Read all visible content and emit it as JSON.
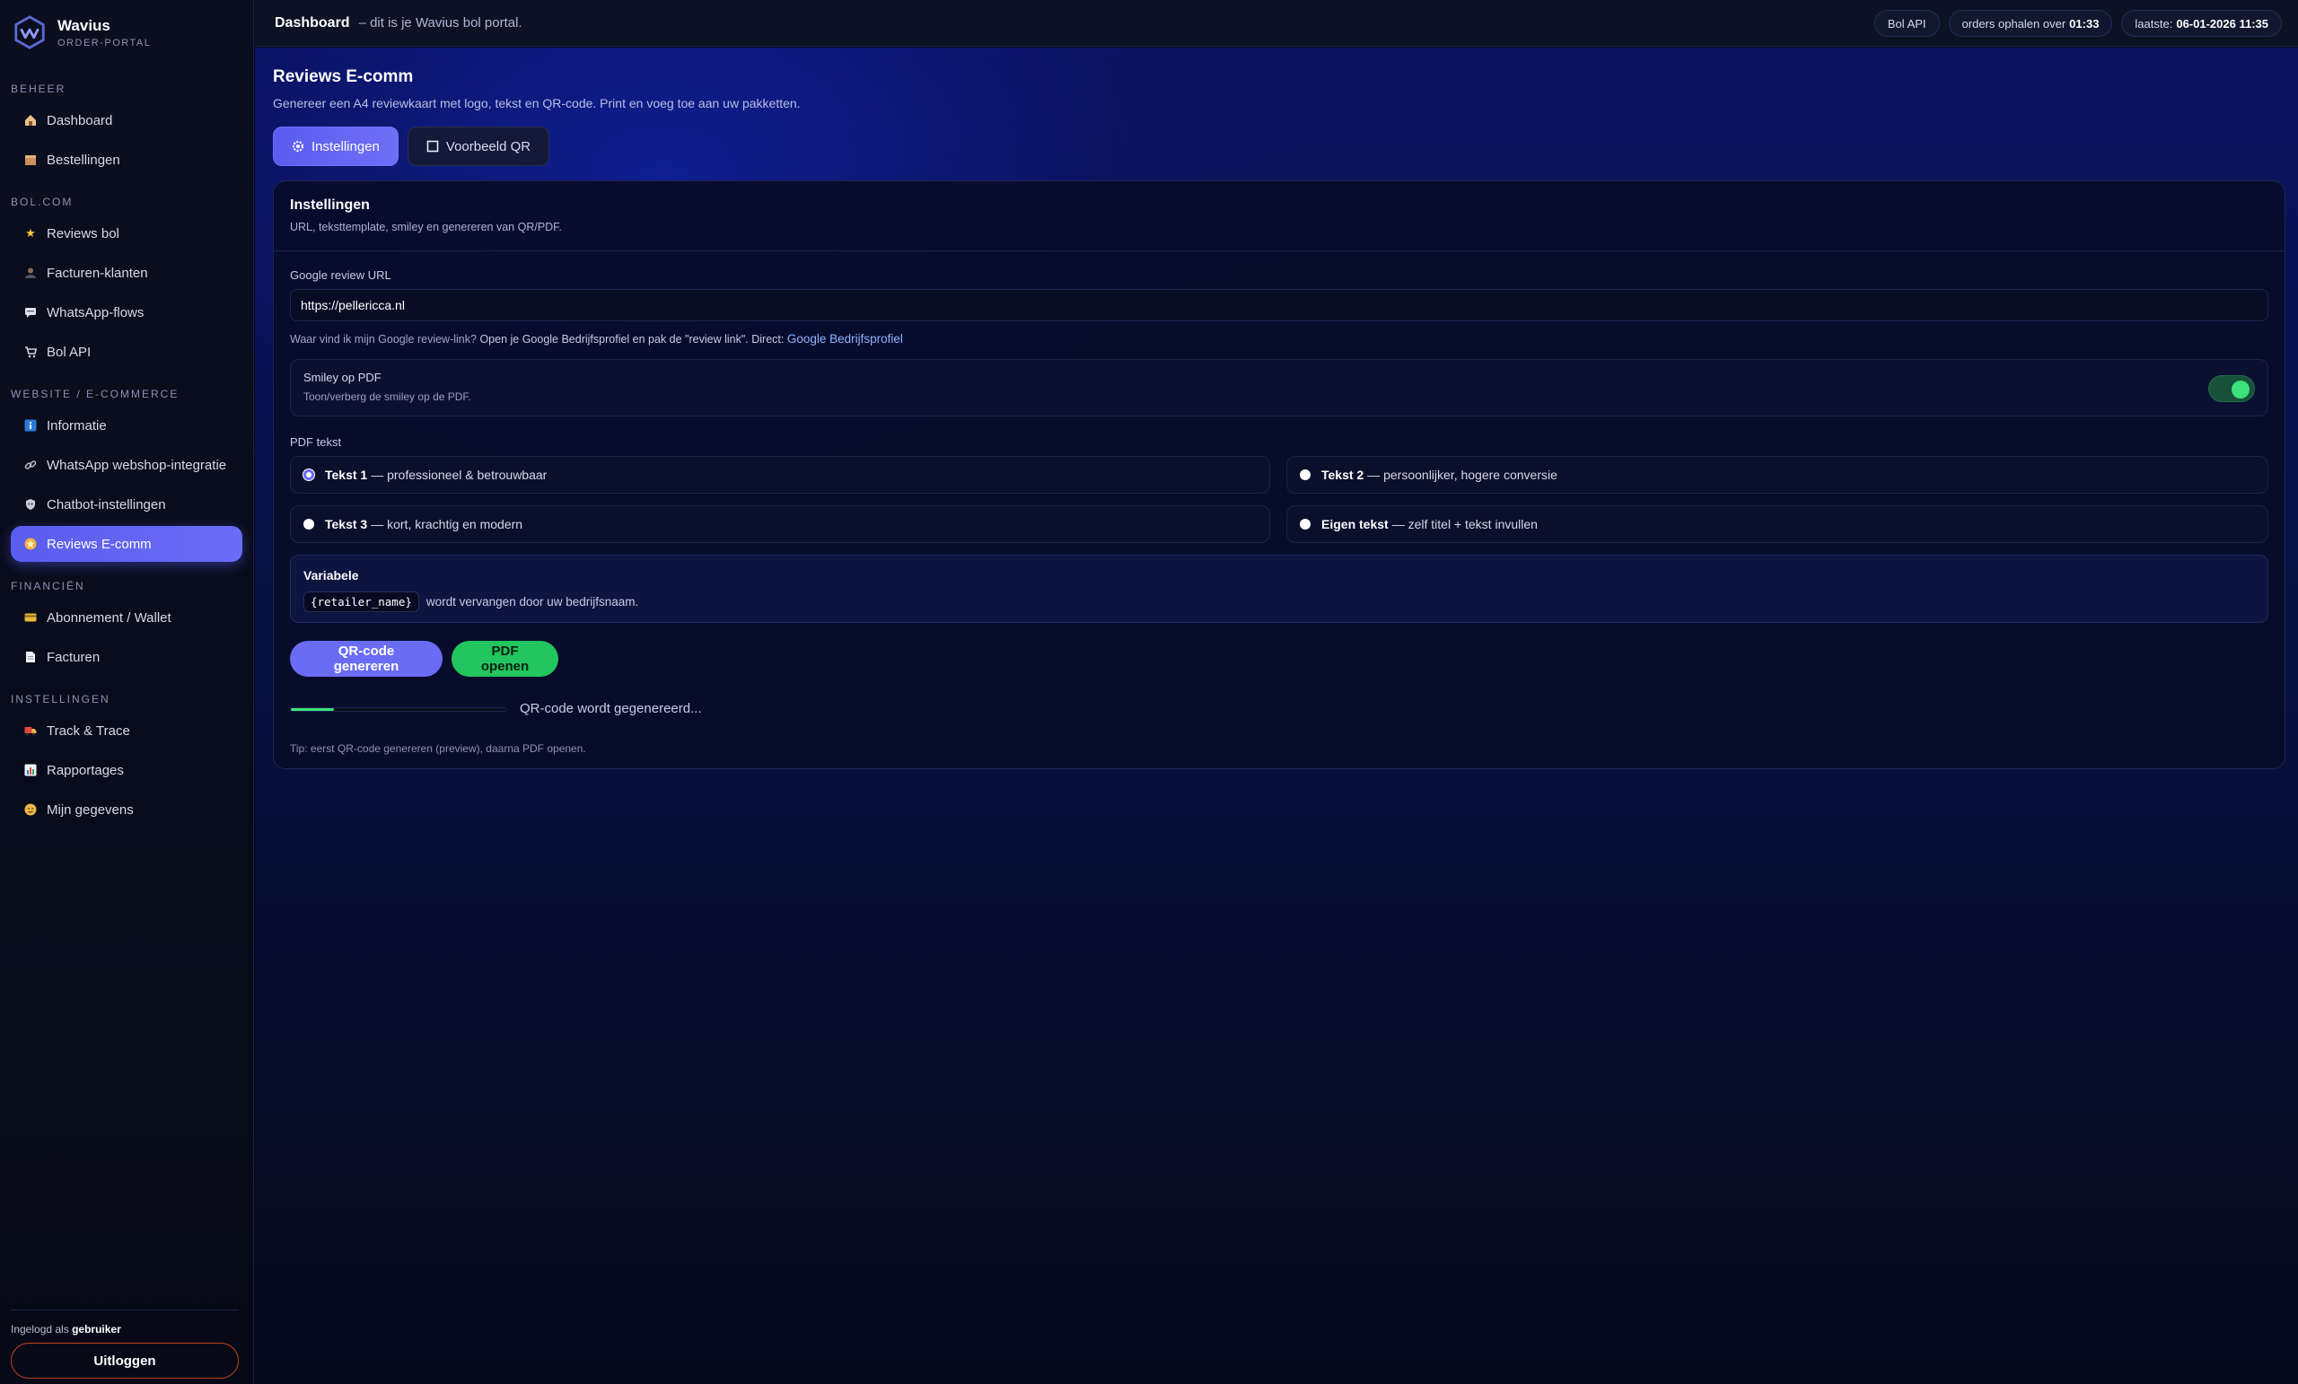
{
  "brand": {
    "name": "Wavius",
    "subtitle": "ORDER-PORTAL"
  },
  "sidebar": {
    "sections": [
      {
        "title": "BEHEER",
        "items": [
          {
            "label": "Dashboard",
            "icon": "house-icon"
          },
          {
            "label": "Bestellingen",
            "icon": "package-icon"
          }
        ]
      },
      {
        "title": "BOL.COM",
        "items": [
          {
            "label": "Reviews bol",
            "icon": "star-icon"
          },
          {
            "label": "Facturen-klanten",
            "icon": "person-icon"
          },
          {
            "label": "WhatsApp-flows",
            "icon": "chat-icon"
          },
          {
            "label": "Bol API",
            "icon": "cart-icon"
          }
        ]
      },
      {
        "title": "WEBSITE / E-COMMERCE",
        "items": [
          {
            "label": "Informatie",
            "icon": "info-icon"
          },
          {
            "label": "WhatsApp webshop-integratie",
            "icon": "link-icon"
          },
          {
            "label": "Chatbot-instellingen",
            "icon": "shield-icon"
          },
          {
            "label": "Reviews E-comm",
            "icon": "star-badge-icon",
            "active": true
          }
        ]
      },
      {
        "title": "FINANCIËN",
        "items": [
          {
            "label": "Abonnement / Wallet",
            "icon": "card-icon"
          },
          {
            "label": "Facturen",
            "icon": "document-icon"
          }
        ]
      },
      {
        "title": "INSTELLINGEN",
        "items": [
          {
            "label": "Track & Trace",
            "icon": "truck-icon"
          },
          {
            "label": "Rapportages",
            "icon": "chart-icon"
          },
          {
            "label": "Mijn gegevens",
            "icon": "face-icon"
          }
        ]
      }
    ],
    "footer": {
      "login_prefix": "Ingelogd als",
      "username": "gebruiker",
      "logout_label": "Uitloggen"
    }
  },
  "topbar": {
    "title": "Dashboard",
    "subtitle": "– dit is je Wavius bol portal.",
    "chips": {
      "api": "Bol API",
      "orders_prefix": "orders ophalen over",
      "orders_time": "01:33",
      "last_prefix": "laatste:",
      "last_time": "06-01-2026 11:35"
    }
  },
  "page": {
    "title": "Reviews E-comm",
    "subtitle": "Genereer een A4 reviewkaart met logo, tekst en QR-code. Print en voeg toe aan uw pakketten.",
    "tabs": [
      {
        "label": "Instellingen",
        "icon": "gear-icon",
        "active": true
      },
      {
        "label": "Voorbeeld QR",
        "icon": "square-icon",
        "active": false
      }
    ]
  },
  "settings": {
    "title": "Instellingen",
    "subtitle": "URL, teksttemplate, smiley en genereren van QR/PDF.",
    "url_label": "Google review URL",
    "url_value": "https://pellericca.nl",
    "hint_prefix": "Waar vind ik mijn Google review-link?",
    "hint_middle": "Open je Google Bedrijfsprofiel en pak de \"review link\". Direct:",
    "hint_link": "Google Bedrijfsprofiel",
    "smiley_title": "Smiley op PDF",
    "smiley_sub": "Toon/verberg de smiley op de PDF.",
    "smiley_on": true,
    "pdf_label": "PDF tekst",
    "options": [
      {
        "bold": "Tekst 1",
        "rest": "— professioneel & betrouwbaar",
        "selected": true
      },
      {
        "bold": "Tekst 2",
        "rest": "— persoonlijker, hogere conversie",
        "selected": false
      },
      {
        "bold": "Tekst 3",
        "rest": "— kort, krachtig en modern",
        "selected": false
      },
      {
        "bold": "Eigen tekst",
        "rest": "— zelf titel + tekst invullen",
        "selected": false
      }
    ],
    "variable_title": "Variabele",
    "variable_code": "{retailer_name}",
    "variable_desc": "wordt vervangen door uw bedrijfsnaam.",
    "btn_qr": "QR-code genereren",
    "btn_pdf": "PDF openen",
    "progress": 0.2,
    "progress_text": "QR-code wordt gegenereerd...",
    "tip": "Tip: eerst QR-code genereren (preview), daarna PDF openen."
  },
  "colors": {
    "accent": "#6a6cf6",
    "success": "#22c55e",
    "danger": "#c2411f"
  }
}
